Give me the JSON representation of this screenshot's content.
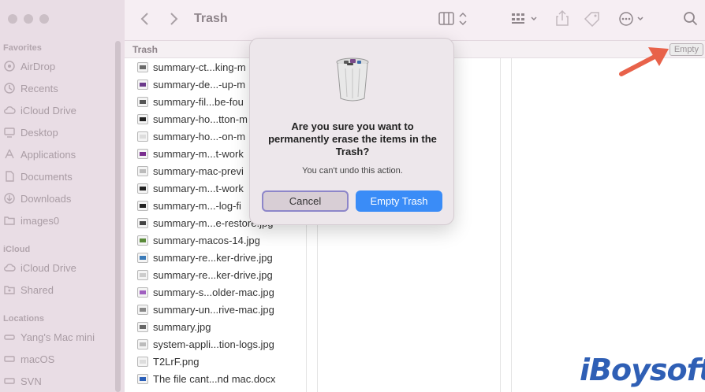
{
  "window": {
    "title": "Trash"
  },
  "sidebar": {
    "favorites_heading": "Favorites",
    "favorites": [
      {
        "label": "AirDrop",
        "icon": "airdrop-icon"
      },
      {
        "label": "Recents",
        "icon": "clock-icon"
      },
      {
        "label": "iCloud Drive",
        "icon": "cloud-icon"
      },
      {
        "label": "Desktop",
        "icon": "desktop-icon"
      },
      {
        "label": "Applications",
        "icon": "applications-icon"
      },
      {
        "label": "Documents",
        "icon": "document-icon"
      },
      {
        "label": "Downloads",
        "icon": "download-icon"
      },
      {
        "label": "images0",
        "icon": "folder-icon"
      }
    ],
    "icloud_heading": "iCloud",
    "icloud": [
      {
        "label": "iCloud Drive",
        "icon": "cloud-icon"
      },
      {
        "label": "Shared",
        "icon": "shared-folder-icon"
      }
    ],
    "locations_heading": "Locations",
    "locations": [
      {
        "label": "Yang's Mac mini",
        "icon": "computer-icon"
      },
      {
        "label": "macOS",
        "icon": "disk-icon"
      },
      {
        "label": "SVN",
        "icon": "disk-icon"
      }
    ]
  },
  "pathbar": {
    "label": "Trash",
    "empty_button": "Empty"
  },
  "files": [
    {
      "name": "summary-ct...king-m",
      "color": "#6a6a6a"
    },
    {
      "name": "summary-de...-up-m",
      "color": "#6b3a8a"
    },
    {
      "name": "summary-fil...be-fou",
      "color": "#555555"
    },
    {
      "name": "summary-ho...tton-m",
      "color": "#222222"
    },
    {
      "name": "summary-ho...-on-m",
      "color": "#dddddd"
    },
    {
      "name": "summary-m...t-work",
      "color": "#7a2f8f"
    },
    {
      "name": "summary-mac-previ",
      "color": "#bbbbbb"
    },
    {
      "name": "summary-m...t-work",
      "color": "#222222"
    },
    {
      "name": "summary-m...-log-fi",
      "color": "#222222"
    },
    {
      "name": "summary-m...e-restore.jpg",
      "color": "#444444"
    },
    {
      "name": "summary-macos-14.jpg",
      "color": "#5a8a3a"
    },
    {
      "name": "summary-re...ker-drive.jpg",
      "color": "#3a7ab8"
    },
    {
      "name": "summary-re...ker-drive.jpg",
      "color": "#cccccc"
    },
    {
      "name": "summary-s...older-mac.jpg",
      "color": "#a060c0"
    },
    {
      "name": "summary-un...rive-mac.jpg",
      "color": "#888888"
    },
    {
      "name": "summary.jpg",
      "color": "#666666"
    },
    {
      "name": "system-appli...tion-logs.jpg",
      "color": "#bbbbbb"
    },
    {
      "name": "T2LrF.png",
      "color": "#dddddd"
    },
    {
      "name": "The file cant...nd mac.docx",
      "color": "#2b5fb8"
    }
  ],
  "dialog": {
    "title": "Are you sure you want to permanently erase the items in the Trash?",
    "message": "You can't undo this action.",
    "cancel_label": "Cancel",
    "confirm_label": "Empty Trash"
  },
  "watermark": {
    "text": "iBoysoft"
  },
  "colors": {
    "accent": "#3a8cf7",
    "arrow": "#e8624a",
    "logo": "#2f5fb5"
  }
}
